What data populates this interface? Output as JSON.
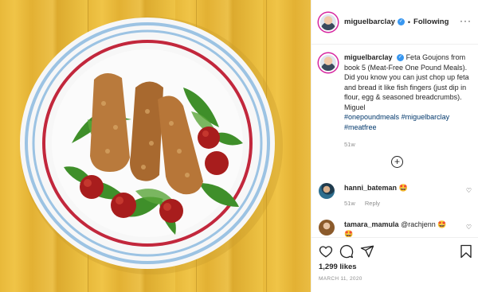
{
  "post": {
    "image_alt": "Feta goujons on rocket salad with roasted tomatoes",
    "account": "miguelbarclay",
    "follow_status": "Following",
    "separator": "•",
    "caption": {
      "username": "miguelbarclay",
      "text": "Feta Goujons from book 5 (Meat-Free One Pound Meals). Did you know you can just chop up feta and bread it like fish fingers (just dip in flour, egg & seasoned breadcrumbs). Miguel",
      "hashtags": [
        "#onepoundmeals",
        "#miguelbarclay",
        "#meatfree"
      ],
      "time": "51w"
    },
    "comments": [
      {
        "username": "hanni_bateman",
        "text": "🤩",
        "time": "51w",
        "reply_label": "Reply"
      },
      {
        "username": "tamara_mamula",
        "text": "@rachjenn 🤩",
        "extra": "🤩"
      }
    ],
    "likes": "1,299 likes",
    "date": "MARCH 11, 2020"
  },
  "colors": {
    "link": "#00376b",
    "verified": "#3897f0",
    "muted": "#8e8e8e"
  },
  "icons": {
    "more": "more-horizontal-icon",
    "add_comments": "plus-circle-icon",
    "like": "heart-icon",
    "comment": "comment-icon",
    "share": "send-icon",
    "save": "bookmark-icon"
  }
}
